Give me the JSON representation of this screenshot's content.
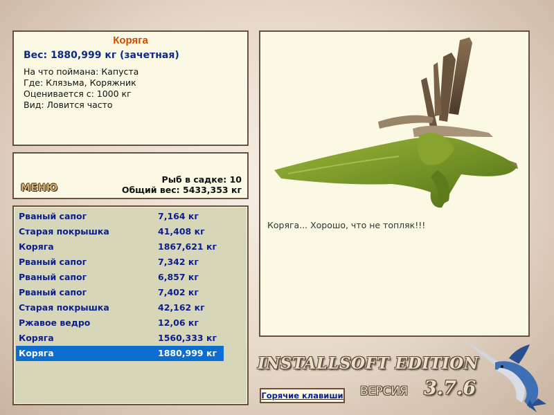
{
  "info": {
    "title": "Коряга",
    "weight_line": "Вес: 1880,999 кг (зачетная)",
    "lines": [
      "На что поймана: Капуста",
      "Где: Клязьма, Коряжник",
      "Оценивается с: 1000 кг",
      "Вид: Ловится часто"
    ]
  },
  "summary": {
    "menu_label": "МЕНЮ",
    "fish_in_keepnet": "Рыб в садке: 10",
    "total_weight": "Общий вес: 5433,353 кг"
  },
  "catch_list": [
    {
      "name": "Рваный сапог",
      "weight": "7,164 кг"
    },
    {
      "name": "Старая покрышка",
      "weight": "41,408 кг"
    },
    {
      "name": "Коряга",
      "weight": "1867,621 кг"
    },
    {
      "name": "Рваный сапог",
      "weight": "7,342 кг"
    },
    {
      "name": "Рваный сапог",
      "weight": "6,857 кг"
    },
    {
      "name": "Рваный сапог",
      "weight": "7,402 кг"
    },
    {
      "name": "Старая покрышка",
      "weight": "42,162 кг"
    },
    {
      "name": "Ржавое ведро",
      "weight": "12,06 кг"
    },
    {
      "name": "Коряга",
      "weight": "1560,333 кг"
    },
    {
      "name": "Коряга",
      "weight": "1880,999 кг",
      "selected": true
    }
  ],
  "image_panel": {
    "caption": "Коряга... Хорошо, что не топляк!!!",
    "image_subject": "snag-driftwood-image"
  },
  "footer": {
    "edition": "INSTALLSOFT EDITION",
    "version_label": "ВЕРСИЯ",
    "version_number": "3.7.6",
    "hotkeys_label": "Горячие клавиши"
  },
  "colors": {
    "panel_bg": "#fbf9e3",
    "panel_border": "#6b4e3a",
    "title": "#c84a00",
    "text_blue": "#0b1f8a",
    "selection": "#0b6ed0"
  }
}
